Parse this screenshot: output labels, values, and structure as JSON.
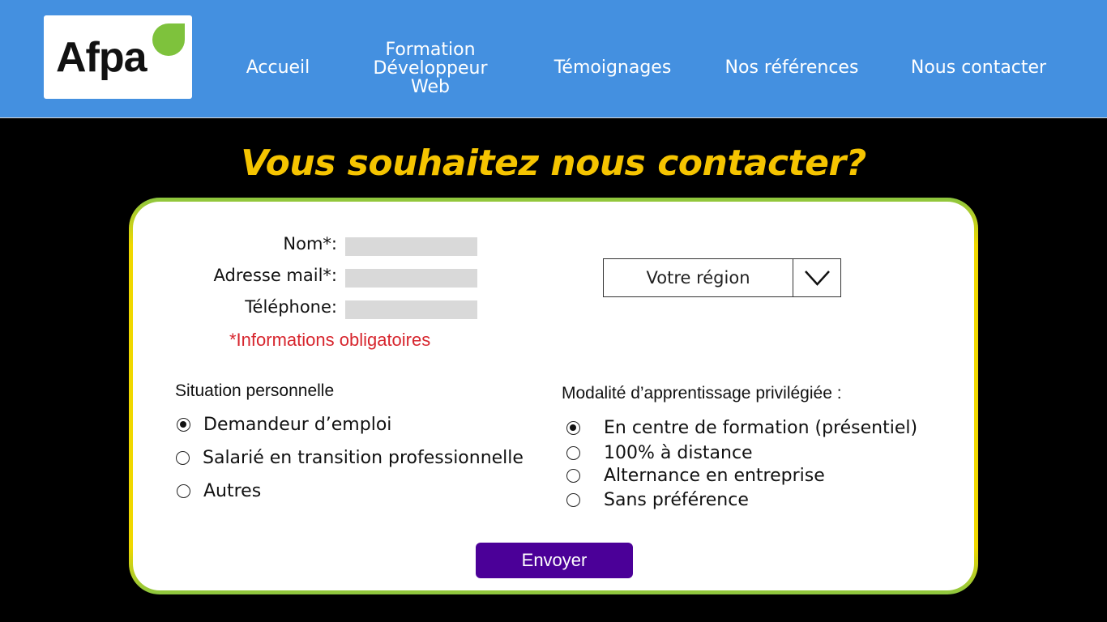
{
  "header": {
    "logo_text": "Afpa",
    "nav": [
      {
        "label": "Accueil"
      },
      {
        "label": "Formation Développeur Web"
      },
      {
        "label": "Témoignages"
      },
      {
        "label": "Nos références"
      },
      {
        "label": "Nous contacter"
      }
    ]
  },
  "page_title": "Vous souhaitez nous contacter?",
  "form": {
    "fields": [
      {
        "label": "Nom*:",
        "value": ""
      },
      {
        "label": "Adresse mail*:",
        "value": ""
      },
      {
        "label": "Téléphone:",
        "value": ""
      }
    ],
    "required_note": "*Informations obligatoires",
    "region_select": {
      "selected": "Votre région"
    },
    "situation": {
      "title": "Situation personnelle",
      "options": [
        {
          "label": "Demandeur d’emploi",
          "checked": true
        },
        {
          "label": "Salarié en transition professionnelle",
          "checked": false
        },
        {
          "label": "Autres",
          "checked": false
        }
      ]
    },
    "modalite": {
      "title": "Modalité d’apprentissage privilégiée :",
      "options": [
        {
          "label": "En centre de formation (présentiel)",
          "checked": true
        },
        {
          "label": "100% à distance",
          "checked": false
        },
        {
          "label": "Alternance en entreprise",
          "checked": false
        },
        {
          "label": "Sans préférence",
          "checked": false
        }
      ]
    },
    "submit_label": "Envoyer"
  },
  "colors": {
    "header_bg": "#4490e0",
    "title_yellow": "#f5c400",
    "frame_green": "#8cc63f",
    "required_red": "#d7262e",
    "button_purple": "#4b0098"
  },
  "icons": {
    "logo_leaf": "leaf-icon",
    "select_arrow": "chevron-down-icon"
  }
}
